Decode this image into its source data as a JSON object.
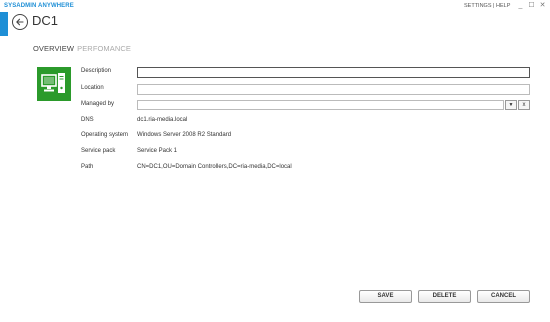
{
  "app": {
    "title": "SYSADMIN ANYWHERE",
    "settings_link": "SETTINGS",
    "link_separator": " | ",
    "help_link": "HELP"
  },
  "window_controls": {
    "minimize": "_",
    "maximize": "☐",
    "close": "✕"
  },
  "page": {
    "title": "DC1"
  },
  "tabs": [
    {
      "label": "OVERVIEW",
      "active": true
    },
    {
      "label": "PERFOMANCE",
      "active": false
    }
  ],
  "form": {
    "description": {
      "label": "Description",
      "value": ""
    },
    "location": {
      "label": "Location",
      "value": ""
    },
    "managed_by": {
      "label": "Managed by",
      "value": "",
      "dropdown_glyph": "▼",
      "clear_glyph": "x"
    },
    "dns": {
      "label": "DNS",
      "value": "dc1.ria-media.local"
    },
    "operating_system": {
      "label": "Operating system",
      "value": "Windows Server 2008 R2 Standard"
    },
    "service_pack": {
      "label": "Service pack",
      "value": "Service Pack 1"
    },
    "path": {
      "label": "Path",
      "value": "CN=DC1,OU=Domain Controllers,DC=ria-media,DC=local"
    }
  },
  "buttons": {
    "save": "SAVE",
    "delete": "DELETE",
    "cancel": "CANCEL"
  },
  "colors": {
    "accent": "#1e8fd6",
    "device_icon_bg": "#2b9a2b"
  },
  "icons": {
    "back": "arrow-left-circle-icon",
    "device": "computer-icon"
  }
}
